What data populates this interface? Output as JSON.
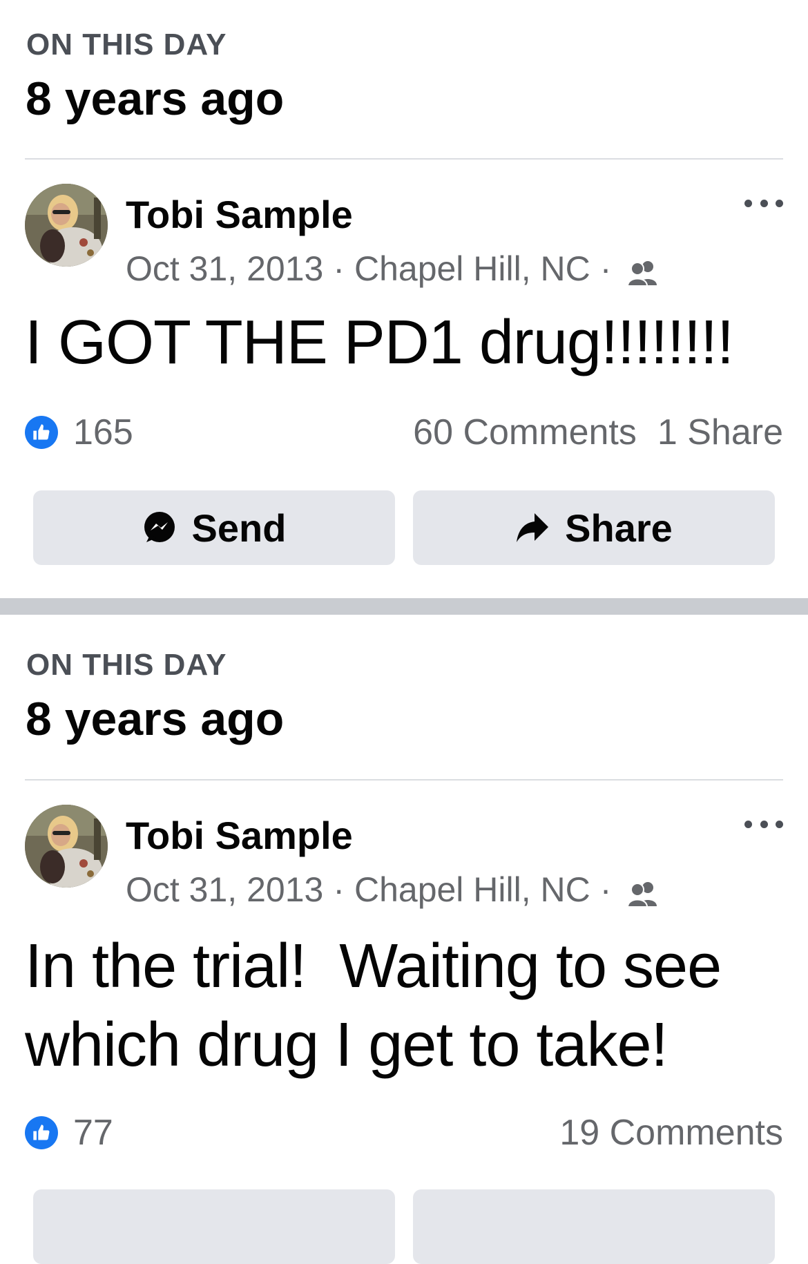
{
  "memories": [
    {
      "heading": "ON THIS DAY",
      "title": "8 years ago",
      "post": {
        "author": "Tobi Sample",
        "date": "Oct 31, 2013",
        "location": "Chapel Hill, NC",
        "separator": "·",
        "audience_icon": "friends-icon",
        "text": "I GOT THE PD1 drug!!!!!!!!",
        "likes": "165",
        "comments": "60 Comments",
        "shares": "1 Share"
      },
      "actions": {
        "send_label": "Send",
        "share_label": "Share"
      }
    },
    {
      "heading": "ON THIS DAY",
      "title": "8 years ago",
      "post": {
        "author": "Tobi Sample",
        "date": "Oct 31, 2013",
        "location": "Chapel Hill, NC",
        "separator": "·",
        "audience_icon": "friends-icon",
        "text": "In the trial!  Waiting to see which drug I get to take!",
        "likes": "77",
        "comments": "19 Comments"
      }
    }
  ],
  "colors": {
    "like_blue": "#1877f2",
    "secondary_text": "#65676b",
    "button_bg": "#e4e6eb",
    "section_separator": "#c9ccd1"
  }
}
